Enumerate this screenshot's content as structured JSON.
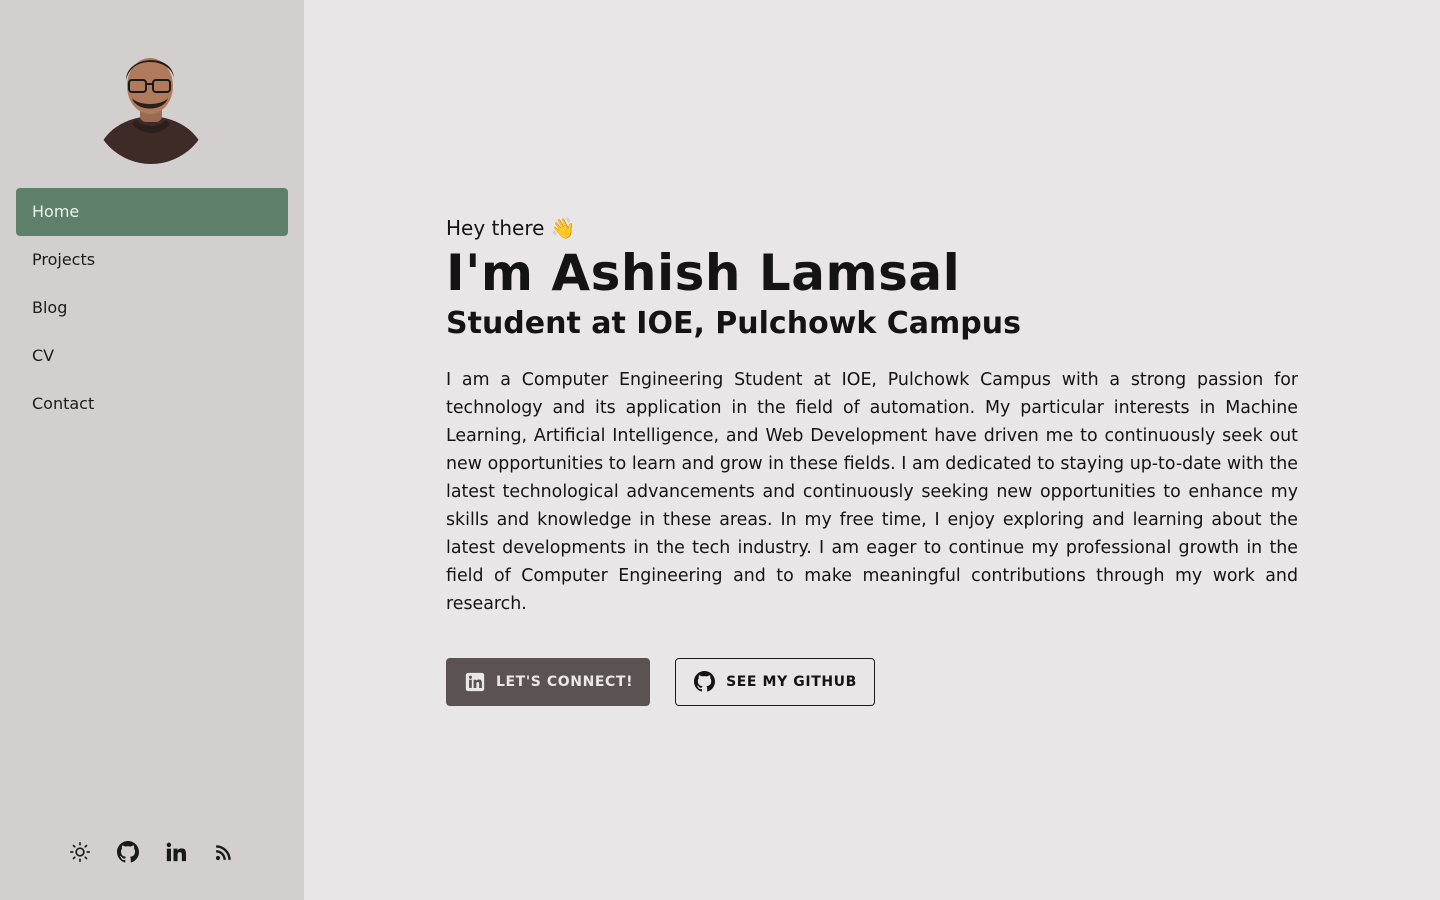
{
  "sidebar": {
    "avatar_alt": "Ashish Lamsal",
    "nav": [
      {
        "label": "Home",
        "active": true
      },
      {
        "label": "Projects",
        "active": false
      },
      {
        "label": "Blog",
        "active": false
      },
      {
        "label": "CV",
        "active": false
      },
      {
        "label": "Contact",
        "active": false
      }
    ],
    "social_icons": [
      "sun-icon",
      "github-icon",
      "linkedin-icon",
      "rss-icon"
    ]
  },
  "hero": {
    "greeting": "Hey there 👋",
    "name": "I'm Ashish Lamsal",
    "subtitle": "Student at IOE, Pulchowk Campus",
    "bio": "I am a Computer Engineering Student at IOE, Pulchowk Campus with a strong passion for technology and its application in the field of automation. My particular interests in Machine Learning, Artificial Intelligence, and Web Development have driven me to continuously seek out new opportunities to learn and grow in these fields. I am dedicated to staying up-to-date with the latest technological advancements and continuously seeking new opportunities to enhance my skills and knowledge in these areas. In my free time, I enjoy exploring and learning about the latest developments in the tech industry. I am eager to continue my professional growth in the field of Computer Engineering and to make meaningful contributions through my work and research.",
    "buttons": {
      "connect": "LET'S CONNECT!",
      "github": "SEE MY GITHUB"
    }
  },
  "colors": {
    "sidebar_bg": "#d3cfcf",
    "page_bg": "#e8e6e7",
    "nav_active": "#5e806a",
    "primary_button": "#5a5352"
  }
}
